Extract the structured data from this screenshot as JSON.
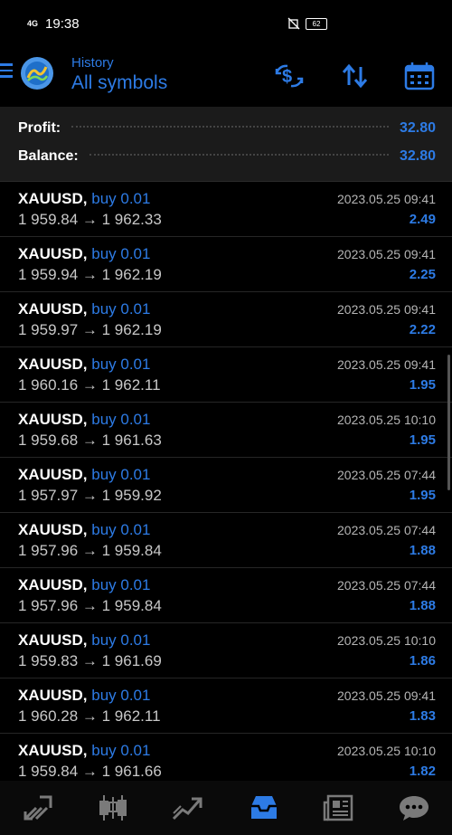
{
  "status_bar": {
    "network": "4G",
    "time": "19:38",
    "battery": "62"
  },
  "header": {
    "subtitle": "History",
    "title": "All symbols"
  },
  "summary": {
    "profit_label": "Profit:",
    "profit_value": "32.80",
    "balance_label": "Balance:",
    "balance_value": "32.80"
  },
  "trades": [
    {
      "symbol": "XAUUSD,",
      "side": "buy 0.01",
      "prices": "1 959.84 → 1 962.33",
      "time": "2023.05.25 09:41",
      "profit": "2.49"
    },
    {
      "symbol": "XAUUSD,",
      "side": "buy 0.01",
      "prices": "1 959.94 → 1 962.19",
      "time": "2023.05.25 09:41",
      "profit": "2.25"
    },
    {
      "symbol": "XAUUSD,",
      "side": "buy 0.01",
      "prices": "1 959.97 → 1 962.19",
      "time": "2023.05.25 09:41",
      "profit": "2.22"
    },
    {
      "symbol": "XAUUSD,",
      "side": "buy 0.01",
      "prices": "1 960.16 → 1 962.11",
      "time": "2023.05.25 09:41",
      "profit": "1.95"
    },
    {
      "symbol": "XAUUSD,",
      "side": "buy 0.01",
      "prices": "1 959.68 → 1 961.63",
      "time": "2023.05.25 10:10",
      "profit": "1.95"
    },
    {
      "symbol": "XAUUSD,",
      "side": "buy 0.01",
      "prices": "1 957.97 → 1 959.92",
      "time": "2023.05.25 07:44",
      "profit": "1.95"
    },
    {
      "symbol": "XAUUSD,",
      "side": "buy 0.01",
      "prices": "1 957.96 → 1 959.84",
      "time": "2023.05.25 07:44",
      "profit": "1.88"
    },
    {
      "symbol": "XAUUSD,",
      "side": "buy 0.01",
      "prices": "1 957.96 → 1 959.84",
      "time": "2023.05.25 07:44",
      "profit": "1.88"
    },
    {
      "symbol": "XAUUSD,",
      "side": "buy 0.01",
      "prices": "1 959.83 → 1 961.69",
      "time": "2023.05.25 10:10",
      "profit": "1.86"
    },
    {
      "symbol": "XAUUSD,",
      "side": "buy 0.01",
      "prices": "1 960.28 → 1 962.11",
      "time": "2023.05.25 09:41",
      "profit": "1.83"
    },
    {
      "symbol": "XAUUSD,",
      "side": "buy 0.01",
      "prices": "1 959.84 → 1 961.66",
      "time": "2023.05.25 10:10",
      "profit": "1.82"
    }
  ],
  "icons": {
    "menu": "hamburger-menu-icon",
    "logo": "metatrader-logo-icon",
    "currency": "currency-exchange-icon",
    "sort": "sort-arrows-icon",
    "calendar": "calendar-icon",
    "nav": [
      "quotes-icon",
      "chart-icon",
      "trade-icon",
      "history-icon",
      "news-icon",
      "messages-icon"
    ]
  },
  "colors": {
    "accent": "#2d7be5",
    "background": "#000000",
    "summary_bg": "#1b1b1b"
  }
}
